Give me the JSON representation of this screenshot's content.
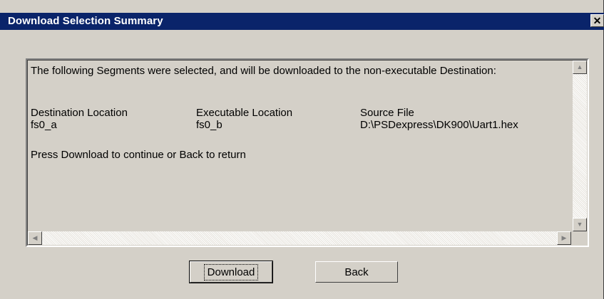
{
  "window": {
    "title": "Download Selection Summary",
    "close_glyph": "✕"
  },
  "summary": {
    "intro": "The following Segments were selected, and will be downloaded to the non-executable Destination:",
    "columns": [
      {
        "header": "Destination Location",
        "value": "fs0_a"
      },
      {
        "header": "Executable Location",
        "value": "fs0_b"
      },
      {
        "header": "Source File",
        "value": "D:\\PSDexpress\\DK900\\Uart1.hex"
      }
    ],
    "instruction": "Press Download to continue or Back to return"
  },
  "scrollbars": {
    "up_glyph": "▲",
    "down_glyph": "▼",
    "left_glyph": "◀",
    "right_glyph": "▶"
  },
  "buttons": {
    "download_label": "Download",
    "back_label": "Back"
  },
  "icons": {
    "close": "close-icon",
    "scroll_up": "arrow-up-icon",
    "scroll_down": "arrow-down-icon",
    "scroll_left": "arrow-left-icon",
    "scroll_right": "arrow-right-icon"
  },
  "colors": {
    "titlebar": "#0a246a",
    "face": "#d4d0c8"
  }
}
